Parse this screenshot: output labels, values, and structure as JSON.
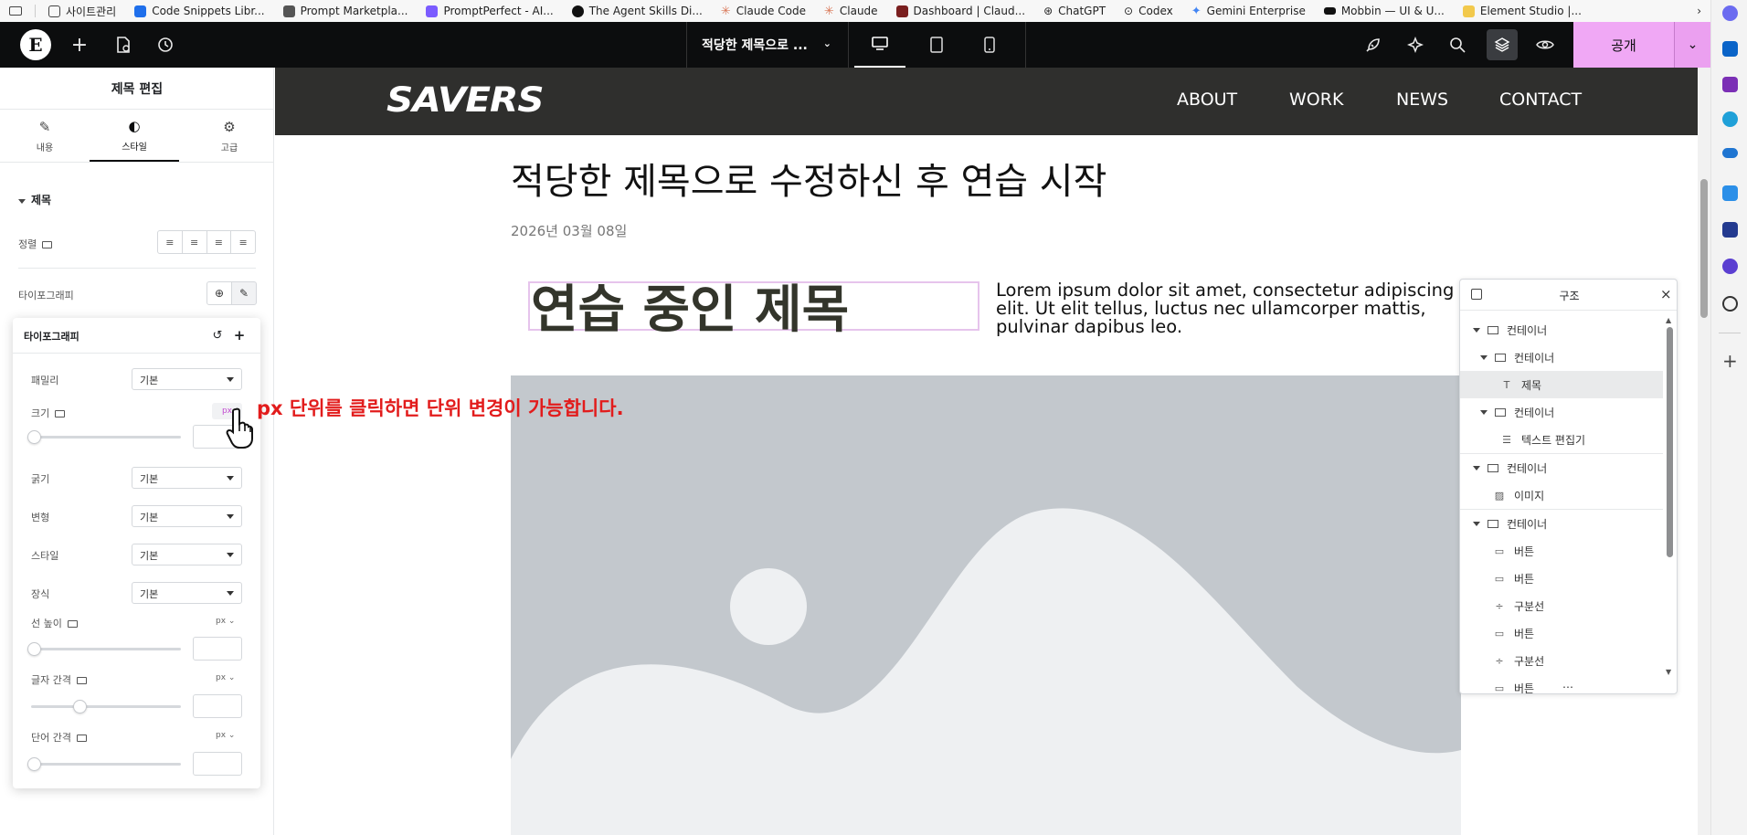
{
  "bookmarks": [
    {
      "label": "사이트관리",
      "color": "#f2c94c"
    },
    {
      "label": "Code Snippets Libr...",
      "color": "#1f6feb"
    },
    {
      "label": "Prompt Marketpla...",
      "color": "#555555"
    },
    {
      "label": "PromptPerfect - AI...",
      "color": "#7b5cff"
    },
    {
      "label": "The Agent Skills Di...",
      "color": "#111111"
    },
    {
      "label": "Claude Code",
      "color": "#d97757"
    },
    {
      "label": "Claude",
      "color": "#d97757"
    },
    {
      "label": "Dashboard | Claud...",
      "color": "#7a1f1f"
    },
    {
      "label": "ChatGPT",
      "color": "#444444"
    },
    {
      "label": "Codex",
      "color": "#444444"
    },
    {
      "label": "Gemini Enterprise",
      "color": "#4285f4"
    },
    {
      "label": "Mobbin — UI & U...",
      "color": "#111111"
    },
    {
      "label": "Element Studio |...",
      "color": "#f2c94c"
    }
  ],
  "topbar": {
    "doc_title": "적당한 제목으로 ...",
    "publish_label": "공개"
  },
  "panel": {
    "title": "제목 편집",
    "tabs": [
      {
        "label": "내용",
        "icon": "pencil-icon"
      },
      {
        "label": "스타일",
        "icon": "half-circle-icon"
      },
      {
        "label": "고급",
        "icon": "gear-icon"
      }
    ],
    "section_title": "제목",
    "align_label": "정렬",
    "typography_label": "타이포그래피"
  },
  "popover": {
    "title": "타이포그래피",
    "family_label": "패밀리",
    "family_value": "기본",
    "size_label": "크기",
    "size_unit": "px",
    "weight_label": "굵기",
    "weight_value": "기본",
    "transform_label": "변형",
    "transform_value": "기본",
    "style_label": "스타일",
    "style_value": "기본",
    "decoration_label": "장식",
    "decoration_value": "기본",
    "line_height_label": "선 높이",
    "letter_spacing_label": "글자 간격",
    "word_spacing_label": "단어 간격",
    "unit_dropdown": "px ⌄"
  },
  "annotation": "px 단위를 클릭하면 단위 변경이 가능합니다.",
  "site": {
    "logo": "SAVERS",
    "nav": [
      "ABOUT",
      "WORK",
      "NEWS",
      "CONTACT"
    ],
    "post_title": "적당한 제목으로 수정하신 후 연습 시작",
    "post_date": "2026년 03월 08일",
    "heading": "연습 중인 제목",
    "lorem": "Lorem ipsum dolor sit amet, consectetur adipiscing elit. Ut elit tellus, luctus nec ullamcorper mattis, pulvinar dapibus leo."
  },
  "navigator": {
    "title": "구조",
    "items": [
      {
        "label": "컨테이너",
        "icon": "container-icon"
      },
      {
        "label": "컨테이너",
        "icon": "container-icon"
      },
      {
        "label": "제목",
        "icon": "heading-icon"
      },
      {
        "label": "컨테이너",
        "icon": "container-icon"
      },
      {
        "label": "텍스트 편집기",
        "icon": "text-editor-icon"
      },
      {
        "label": "컨테이너",
        "icon": "container-icon"
      },
      {
        "label": "이미지",
        "icon": "image-icon"
      },
      {
        "label": "컨테이너",
        "icon": "container-icon"
      },
      {
        "label": "버튼",
        "icon": "button-icon"
      },
      {
        "label": "버튼",
        "icon": "button-icon"
      },
      {
        "label": "구분선",
        "icon": "divider-icon"
      },
      {
        "label": "버튼",
        "icon": "button-icon"
      },
      {
        "label": "구분선",
        "icon": "divider-icon"
      },
      {
        "label": "버튼",
        "icon": "button-icon"
      }
    ]
  },
  "colors": {
    "accent": "#f0a8f5",
    "annotation_red": "#e21c1c",
    "header_bg": "#2f2f2d",
    "image_placeholder": "#c3c8cd"
  }
}
